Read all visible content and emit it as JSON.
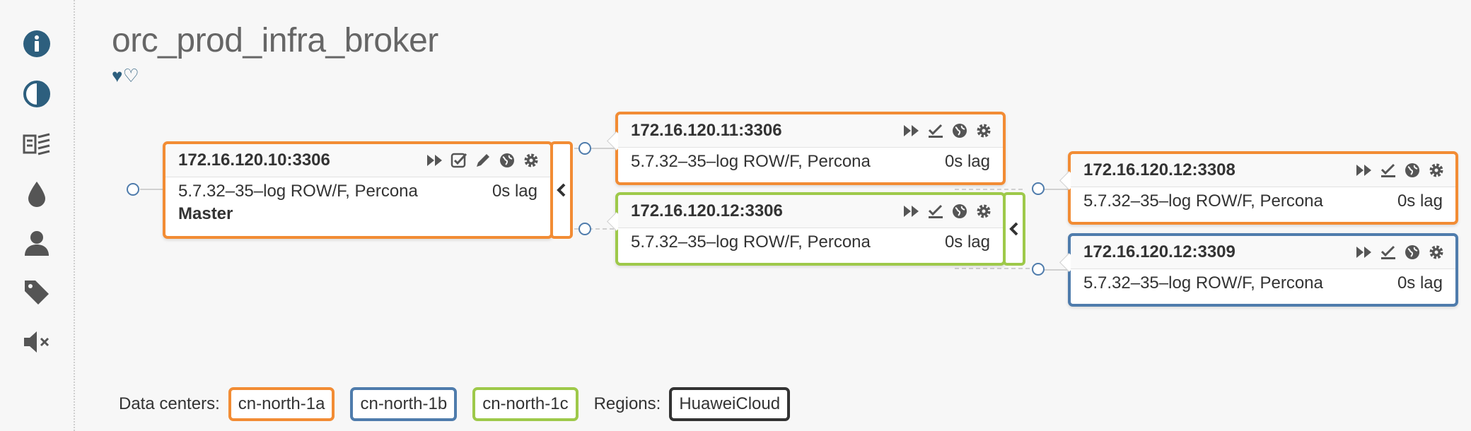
{
  "cluster": {
    "title": "orc_prod_infra_broker",
    "hearts": [
      "♥",
      "♡"
    ]
  },
  "sidebar": {
    "items": [
      {
        "icon": "info-icon"
      },
      {
        "icon": "contrast-icon"
      },
      {
        "icon": "replication-icon"
      },
      {
        "icon": "drop-icon"
      },
      {
        "icon": "user-icon"
      },
      {
        "icon": "tag-icon"
      },
      {
        "icon": "mute-icon"
      }
    ]
  },
  "nodes": {
    "master": {
      "host": "172.16.120.10:3306",
      "version": "5.7.32–35–log ROW/F, Percona",
      "lag": "0s lag",
      "role": "Master",
      "dc_color": "#f28c34"
    },
    "replica1": {
      "host": "172.16.120.11:3306",
      "version": "5.7.32–35–log ROW/F, Percona",
      "lag": "0s lag",
      "dc_color": "#f28c34"
    },
    "replica2": {
      "host": "172.16.120.12:3306",
      "version": "5.7.32–35–log ROW/F, Percona",
      "lag": "0s lag",
      "dc_color": "#9ec94a"
    },
    "replica3": {
      "host": "172.16.120.12:3308",
      "version": "5.7.32–35–log ROW/F, Percona",
      "lag": "0s lag",
      "dc_color": "#f28c34"
    },
    "replica4": {
      "host": "172.16.120.12:3309",
      "version": "5.7.32–35–log ROW/F, Percona",
      "lag": "0s lag",
      "dc_color": "#4f7cac"
    }
  },
  "legend": {
    "dc_label": "Data centers:",
    "dcs": [
      "cn-north-1a",
      "cn-north-1b",
      "cn-north-1c"
    ],
    "regions_label": "Regions:",
    "regions": [
      "HuaweiCloud"
    ]
  }
}
